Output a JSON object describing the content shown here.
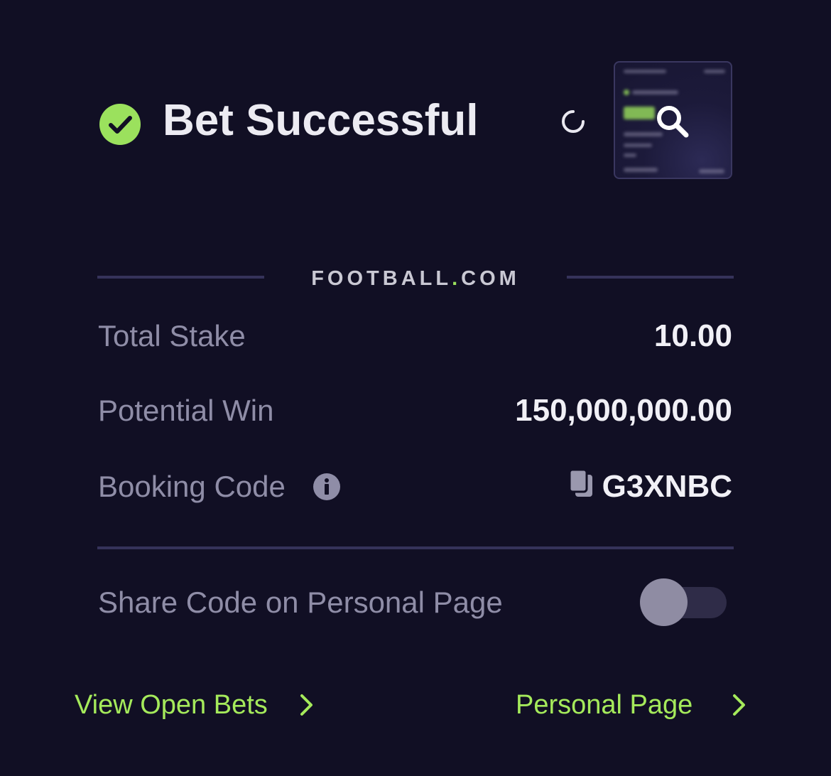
{
  "header": {
    "title": "Bet Successful",
    "status_icon": "check-circle-icon",
    "refresh_icon": "refresh-icon",
    "thumbnail_icon": "search-icon"
  },
  "brand": {
    "name_prefix": "FOOTBALL",
    "name_dot": ".",
    "name_suffix": "COM"
  },
  "details": {
    "total_stake_label": "Total Stake",
    "total_stake_value": "10.00",
    "potential_win_label": "Potential Win",
    "potential_win_value": "150,000,000.00",
    "booking_code_label": "Booking Code",
    "booking_code_value": "G3XNBC"
  },
  "share": {
    "label": "Share Code on Personal Page",
    "enabled": false
  },
  "footer": {
    "view_open_bets": "View Open Bets",
    "personal_page": "Personal Page"
  },
  "colors": {
    "background": "#110f24",
    "accent_green": "#a5ea5b",
    "check_green": "#9be15d",
    "divider": "#35325a"
  }
}
